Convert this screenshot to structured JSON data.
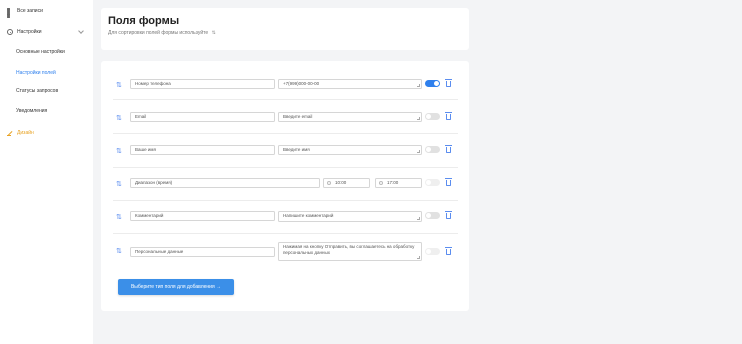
{
  "sidebar": {
    "all_records": "Все записи",
    "settings": "Настройки",
    "sub_items": [
      {
        "label": "Основные настройки"
      },
      {
        "label": "Настройки полей"
      },
      {
        "label": "Статусы запросов"
      },
      {
        "label": "Уведомления"
      }
    ],
    "design": "Дизайн"
  },
  "header": {
    "title": "Поля формы",
    "subtitle": "Для сортировки полей формы используйте"
  },
  "fields": [
    {
      "name": "Номер телефона",
      "placeholder": "+7(999)000-00-00",
      "toggle": "on"
    },
    {
      "name": "Email",
      "placeholder": "Введите email",
      "toggle": "off"
    },
    {
      "name": "Ваше имя",
      "placeholder": "Введите имя",
      "toggle": "off"
    },
    {
      "name": "Диапазон (время)",
      "time_from": "10:00",
      "time_to": "17:00",
      "toggle": "disabled"
    },
    {
      "name": "Комментарий",
      "placeholder": "Напишите комментарий",
      "toggle": "off"
    },
    {
      "name": "Персональные данные",
      "placeholder": "Нажимая на кнопку Отправить, вы соглашаетесь на обработку персональных данных",
      "toggle": "disabled"
    }
  ],
  "add_button": "Выберите тип поля для добавления →",
  "colors": {
    "accent": "#2f80ed",
    "design": "#e8a325"
  },
  "icons": {
    "drag": "drag-handle-icon",
    "trash": "trash-icon",
    "clock": "clock-icon"
  }
}
